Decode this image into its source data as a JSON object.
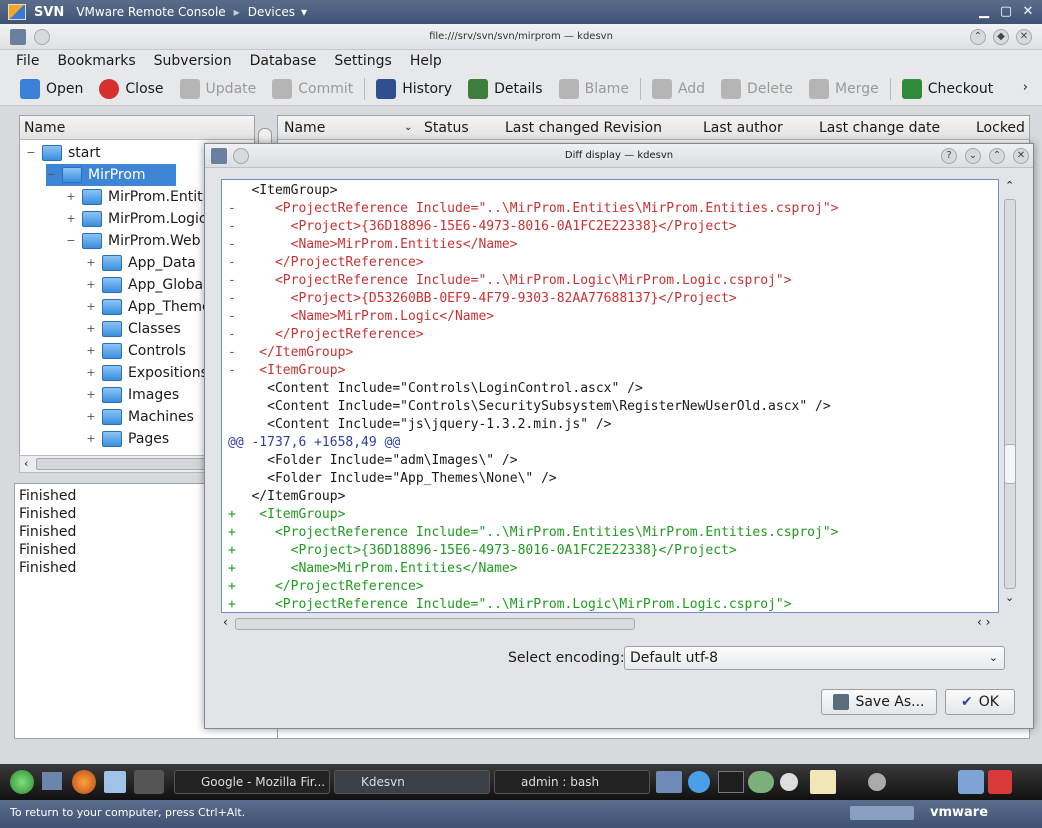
{
  "vmbar": {
    "app": "SVN",
    "title": "VMware Remote Console",
    "devices": "Devices"
  },
  "window": {
    "title": "file:///srv/svn/svn/mirprom — kdesvn"
  },
  "menu": [
    "File",
    "Bookmarks",
    "Subversion",
    "Database",
    "Settings",
    "Help"
  ],
  "toolbar": [
    {
      "label": "Open",
      "enabled": true,
      "color": "#3b7fd6"
    },
    {
      "label": "Close",
      "enabled": true,
      "color": "#d7302c"
    },
    {
      "label": "Update",
      "enabled": false,
      "color": "#b5b5b5"
    },
    {
      "label": "Commit",
      "enabled": false,
      "color": "#b5b5b5"
    },
    {
      "label": "History",
      "enabled": true,
      "color": "#2f4f8f"
    },
    {
      "label": "Details",
      "enabled": true,
      "color": "#3d7d3d"
    },
    {
      "label": "Blame",
      "enabled": false,
      "color": "#b5b5b5"
    },
    {
      "label": "Add",
      "enabled": false,
      "color": "#b5b5b5"
    },
    {
      "label": "Delete",
      "enabled": false,
      "color": "#b5b5b5"
    },
    {
      "label": "Merge",
      "enabled": false,
      "color": "#b5b5b5"
    },
    {
      "label": "Checkout",
      "enabled": true,
      "color": "#2f8a3a"
    }
  ],
  "tree": {
    "header": "Name",
    "items": [
      {
        "label": "start",
        "expander": "−"
      },
      {
        "label": "MirProm",
        "expander": "−",
        "selected": true
      },
      {
        "label": "MirProm.Entities",
        "expander": "+"
      },
      {
        "label": "MirProm.Logic",
        "expander": "+"
      },
      {
        "label": "MirProm.Web",
        "expander": "−"
      },
      {
        "label": "App_Data",
        "expander": "+"
      },
      {
        "label": "App_GlobalResources",
        "expander": "+"
      },
      {
        "label": "App_Themes",
        "expander": "+"
      },
      {
        "label": "Classes",
        "expander": "+"
      },
      {
        "label": "Controls",
        "expander": "+"
      },
      {
        "label": "Expositions",
        "expander": "+"
      },
      {
        "label": "Images",
        "expander": "+"
      },
      {
        "label": "Machines",
        "expander": "+"
      },
      {
        "label": "Pages",
        "expander": "+"
      }
    ]
  },
  "log": [
    "Finished",
    "Finished",
    "Finished",
    "Finished",
    "Finished"
  ],
  "columns": [
    "Name",
    "Status",
    "Last changed Revision",
    "Last author",
    "Last change date",
    "Locked"
  ],
  "dialog": {
    "title": "Diff display — kdesvn",
    "encoding_label": "Select encoding:",
    "encoding_value": "Default utf-8",
    "save_label": "Save As...",
    "ok_label": "OK"
  },
  "diff_lines": [
    {
      "type": "ctx",
      "text": "   <ItemGroup>"
    },
    {
      "type": "rem",
      "text": "-     <ProjectReference Include=\"..\\MirProm.Entities\\MirProm.Entities.csproj\">"
    },
    {
      "type": "rem",
      "text": "-       <Project>{36D18896-15E6-4973-8016-0A1FC2E22338}</Project>"
    },
    {
      "type": "rem",
      "text": "-       <Name>MirProm.Entities</Name>"
    },
    {
      "type": "rem",
      "text": "-     </ProjectReference>"
    },
    {
      "type": "rem",
      "text": "-     <ProjectReference Include=\"..\\MirProm.Logic\\MirProm.Logic.csproj\">"
    },
    {
      "type": "rem",
      "text": "-       <Project>{D53260BB-0EF9-4F79-9303-82AA77688137}</Project>"
    },
    {
      "type": "rem",
      "text": "-       <Name>MirProm.Logic</Name>"
    },
    {
      "type": "rem",
      "text": "-     </ProjectReference>"
    },
    {
      "type": "rem",
      "text": "-   </ItemGroup>"
    },
    {
      "type": "rem",
      "text": "-   <ItemGroup>"
    },
    {
      "type": "ctx",
      "text": "     <Content Include=\"Controls\\LoginControl.ascx\" />"
    },
    {
      "type": "ctx",
      "text": "     <Content Include=\"Controls\\SecuritySubsystem\\RegisterNewUserOld.ascx\" />"
    },
    {
      "type": "ctx",
      "text": "     <Content Include=\"js\\jquery-1.3.2.min.js\" />"
    },
    {
      "type": "hunk",
      "text": "@@ -1737,6 +1658,49 @@"
    },
    {
      "type": "ctx",
      "text": "     <Folder Include=\"adm\\Images\\\" />"
    },
    {
      "type": "ctx",
      "text": "     <Folder Include=\"App_Themes\\None\\\" />"
    },
    {
      "type": "ctx",
      "text": "   </ItemGroup>"
    },
    {
      "type": "add",
      "text": "+   <ItemGroup>"
    },
    {
      "type": "add",
      "text": "+     <ProjectReference Include=\"..\\MirProm.Entities\\MirProm.Entities.csproj\">"
    },
    {
      "type": "add",
      "text": "+       <Project>{36D18896-15E6-4973-8016-0A1FC2E22338}</Project>"
    },
    {
      "type": "add",
      "text": "+       <Name>MirProm.Entities</Name>"
    },
    {
      "type": "add",
      "text": "+     </ProjectReference>"
    },
    {
      "type": "add",
      "text": "+     <ProjectReference Include=\"..\\MirProm.Logic\\MirProm.Logic.csproj\">"
    }
  ],
  "taskbar": [
    {
      "label": "Google - Mozilla Fir..."
    },
    {
      "label": "Kdesvn"
    },
    {
      "label": "admin : bash"
    }
  ],
  "status": "To return to your computer, press Ctrl+Alt.",
  "vmware": "vmware"
}
